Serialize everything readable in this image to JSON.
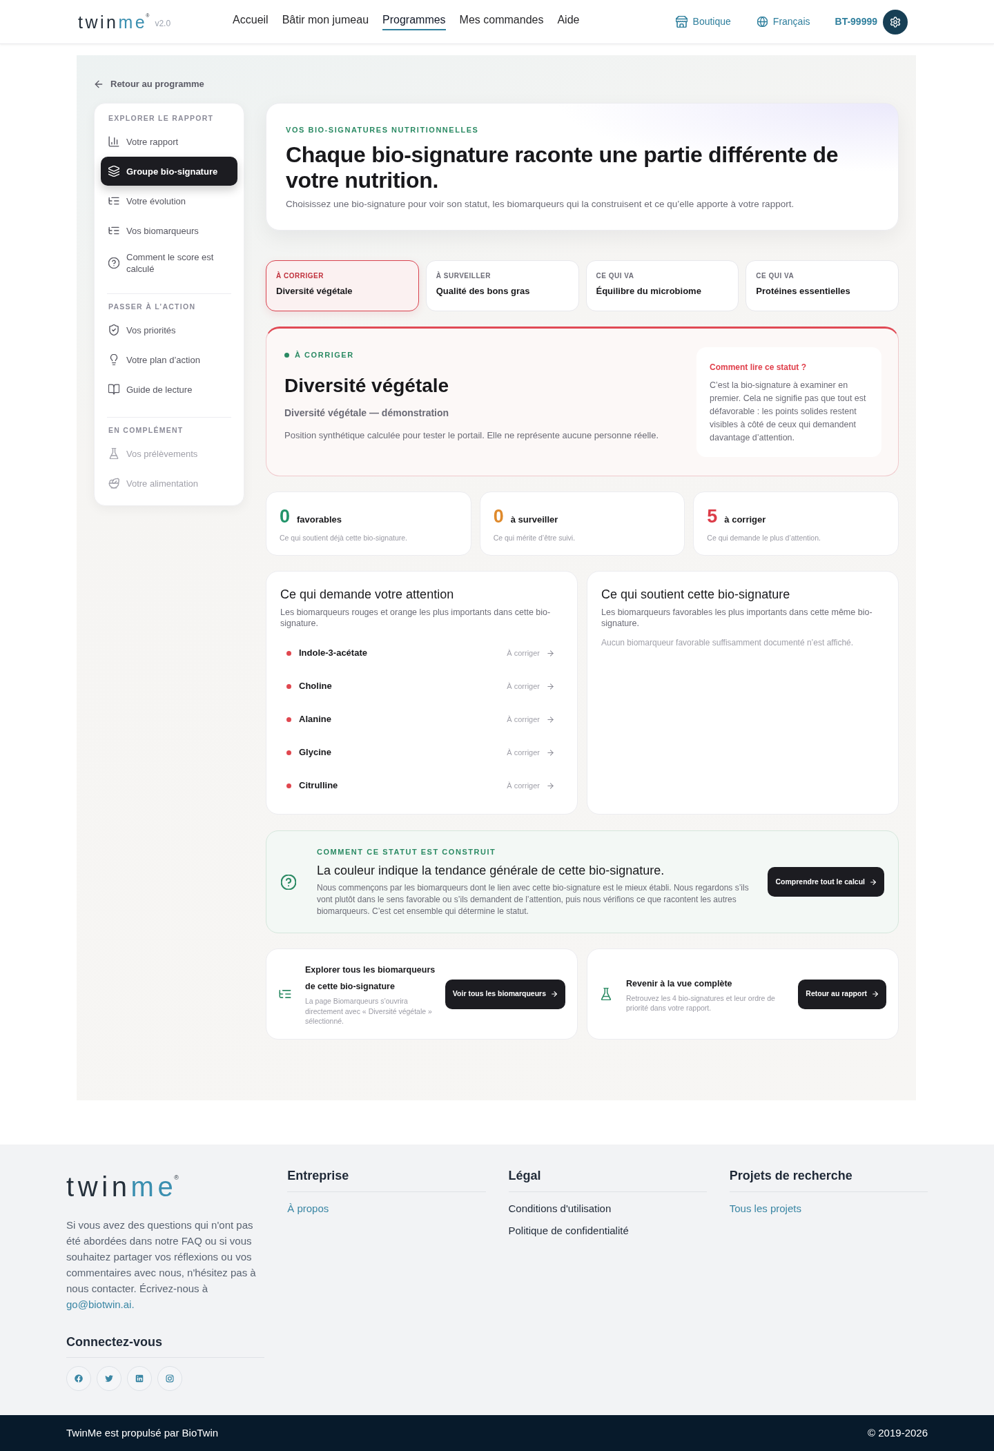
{
  "header": {
    "logo": {
      "parts": [
        "twin",
        "me"
      ],
      "mark": "®"
    },
    "version": "v2.0",
    "nav": [
      {
        "label": "Accueil",
        "selected": false
      },
      {
        "label": "Bâtir mon jumeau",
        "selected": false
      },
      {
        "label": "Programmes",
        "selected": true
      },
      {
        "label": "Mes commandes",
        "selected": false
      },
      {
        "label": "Aide",
        "selected": false
      }
    ],
    "shop": "Boutique",
    "language": "Français",
    "account": "BT-99999"
  },
  "back_link": "Retour au programme",
  "sidebar": {
    "sections": [
      {
        "title": "EXPLORER LE RAPPORT",
        "items": [
          {
            "label": "Votre rapport",
            "selected": false,
            "disabled": false
          },
          {
            "label": "Groupe bio-signature",
            "selected": true,
            "disabled": false
          },
          {
            "label": "Votre évolution",
            "selected": false,
            "disabled": false
          },
          {
            "label": "Vos biomarqueurs",
            "selected": false,
            "disabled": false
          },
          {
            "label": "Comment le score est calculé",
            "selected": false,
            "disabled": false
          }
        ]
      },
      {
        "title": "PASSER À L’ACTION",
        "items": [
          {
            "label": "Vos priorités",
            "selected": false,
            "disabled": false
          },
          {
            "label": "Votre plan d’action",
            "selected": false,
            "disabled": false
          },
          {
            "label": "Guide de lecture",
            "selected": false,
            "disabled": false
          }
        ]
      },
      {
        "title": "EN COMPLÉMENT",
        "items": [
          {
            "label": "Vos prélèvements",
            "selected": false,
            "disabled": true
          },
          {
            "label": "Votre alimentation",
            "selected": false,
            "disabled": true
          }
        ]
      }
    ]
  },
  "intro": {
    "eyebrow": "VOS BIO-SIGNATURES NUTRITIONNELLES",
    "title": "Chaque bio-signature raconte une partie différente de votre nutrition.",
    "subtitle": "Choisissez une bio-signature pour voir son statut, les biomarqueurs qui la construisent et ce qu’elle apporte à votre rapport."
  },
  "signature_tabs": [
    {
      "status": "À CORRIGER",
      "name": "Diversité végétale",
      "selected": true
    },
    {
      "status": "À SURVEILLER",
      "name": "Qualité des bons gras",
      "selected": false
    },
    {
      "status": "CE QUI VA",
      "name": "Équilibre du microbiome",
      "selected": false
    },
    {
      "status": "CE QUI VA",
      "name": "Protéines essentielles",
      "selected": false
    }
  ],
  "status_card": {
    "status": "À CORRIGER",
    "color": "#2a8a63",
    "title": "Diversité végétale",
    "subtitle": "Diversité végétale — démonstration",
    "description": "Position synthétique calculée pour tester le portail. Elle ne représente aucune personne réelle.",
    "help": {
      "title": "Comment lire ce statut ?",
      "text": "C’est la bio-signature à examiner en premier. Cela ne signifie pas que tout est défavorable : les points solides restent visibles à côté de ceux qui demandent davantage d’attention."
    }
  },
  "counts": [
    {
      "value": "0",
      "label": "favorables",
      "description": "Ce qui soutient déjà cette bio-signature.",
      "color": "#22946a"
    },
    {
      "value": "0",
      "label": "à surveiller",
      "description": "Ce qui mérite d’être suivi.",
      "color": "#df8a2c"
    },
    {
      "value": "5",
      "label": "à corriger",
      "description": "Ce qui demande le plus d’attention.",
      "color": "#dc3c48"
    }
  ],
  "attention": {
    "title": "Ce qui demande votre attention",
    "description": "Les biomarqueurs rouges et orange les plus importants dans cette bio-signature.",
    "items": [
      {
        "name": "Indole-3-acétate",
        "status": "À corriger",
        "color": "#e0474f"
      },
      {
        "name": "Choline",
        "status": "À corriger",
        "color": "#e0474f"
      },
      {
        "name": "Alanine",
        "status": "À corriger",
        "color": "#e0474f"
      },
      {
        "name": "Glycine",
        "status": "À corriger",
        "color": "#e0474f"
      },
      {
        "name": "Citrulline",
        "status": "À corriger",
        "color": "#e0474f"
      }
    ]
  },
  "support": {
    "title": "Ce qui soutient cette bio-signature",
    "description": "Les biomarqueurs favorables les plus importants dans cette même bio-signature.",
    "empty": "Aucun biomarqueur favorable suffisamment documenté n’est affiché."
  },
  "method": {
    "eyebrow": "COMMENT CE STATUT EST CONSTRUIT",
    "title": "La couleur indique la tendance générale de cette bio-signature.",
    "text": "Nous commençons par les biomarqueurs dont le lien avec cette bio-signature est le mieux établi. Nous regardons s’ils vont plutôt dans le sens favorable ou s’ils demandent de l’attention, puis nous vérifions ce que racontent les autres biomarqueurs. C’est cet ensemble qui détermine le statut.",
    "button": "Comprendre tout le calcul"
  },
  "actions": [
    {
      "title": "Explorer tous les biomarqueurs de cette bio-signature",
      "description": "La page Biomarqueurs s’ouvrira directement avec « Diversité végétale » sélectionné.",
      "button": "Voir tous les biomarqueurs"
    },
    {
      "title": "Revenir à la vue complète",
      "description": "Retrouvez les 4 bio-signatures et leur ordre de priorité dans votre rapport.",
      "button": "Retour au rapport"
    }
  ],
  "footer": {
    "logo": {
      "parts": [
        "twin",
        "me"
      ],
      "mark": "®"
    },
    "about": "Si vous avez des questions qui n'ont pas été abordées dans notre FAQ ou si vous souhaitez partager vos réflexions ou vos commentaires avec nous, n'hésitez pas à nous contacter. Écrivez-nous à",
    "email": "go@biotwin.ai.",
    "social_title": "Connectez-vous",
    "columns": [
      {
        "title": "Entreprise",
        "links": [
          {
            "label": "À propos",
            "color": "#3a86a4"
          }
        ]
      },
      {
        "title": "Légal",
        "links": [
          {
            "label": "Conditions d'utilisation",
            "color": "#1f2937"
          },
          {
            "label": "Politique de confidentialité",
            "color": "#1f2937"
          }
        ]
      },
      {
        "title": "Projets de recherche",
        "links": [
          {
            "label": "Tous les projets",
            "color": "#3a86a4"
          }
        ]
      }
    ]
  },
  "bottom_bar": {
    "credit": "TwinMe est propulsé par BioTwin",
    "copyright": "© 2019-2026"
  }
}
